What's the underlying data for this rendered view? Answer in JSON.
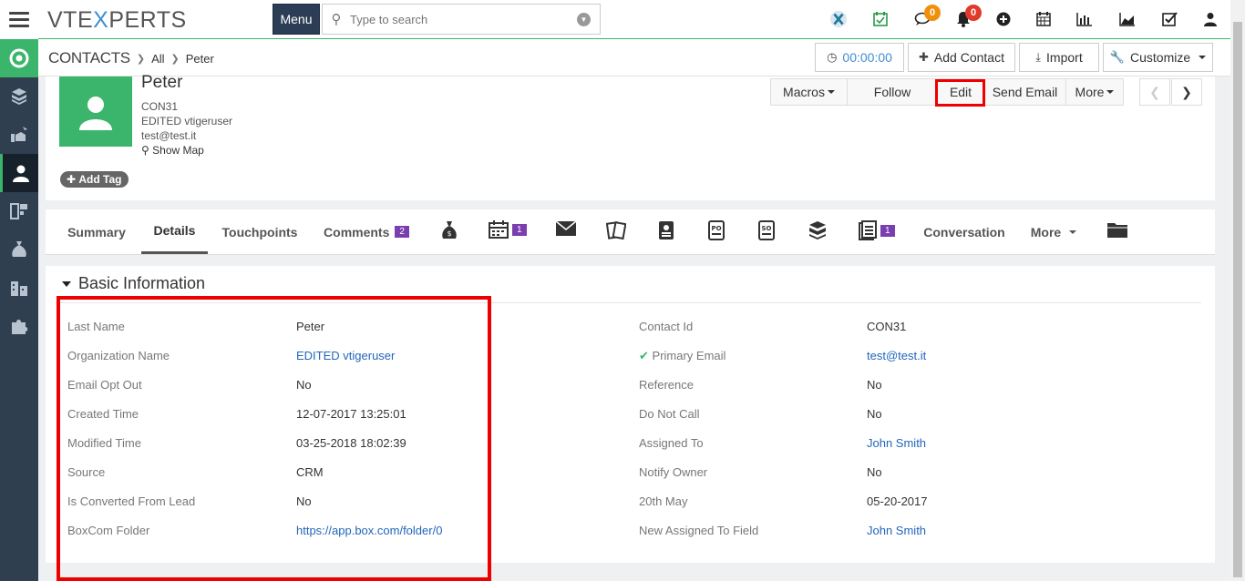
{
  "topbar": {
    "logo_left": "VTE",
    "logo_x": "X",
    "logo_right": "PERTS",
    "menu_label": "Menu",
    "search_placeholder": "Type to search",
    "chat_count": "0",
    "notif_count": "0",
    "chat_badge_color": "#f0900a",
    "notif_badge_color": "#e03a2a"
  },
  "breadcrumb": {
    "module": "CONTACTS",
    "filter": "All",
    "record": "Peter"
  },
  "header_buttons": {
    "timer": "00:00:00",
    "add_contact": "Add Contact",
    "import": "Import",
    "customize": "Customize"
  },
  "record": {
    "name": "Peter",
    "number": "CON31",
    "organization": "EDITED vtigeruser",
    "email": "test@test.it",
    "show_map": "Show Map",
    "add_tag": "Add Tag"
  },
  "actions": {
    "macros": "Macros",
    "follow": "Follow",
    "edit": "Edit",
    "send_email": "Send Email",
    "more": "More"
  },
  "tabs": {
    "summary": "Summary",
    "details": "Details",
    "touchpoints": "Touchpoints",
    "comments": "Comments",
    "comments_count": "2",
    "calendar_count": "1",
    "docs_count": "1",
    "conversation": "Conversation",
    "more": "More"
  },
  "section": {
    "title": "Basic Information",
    "left_fields": [
      {
        "label": "Last Name",
        "value": "Peter"
      },
      {
        "label": "Organization Name",
        "value": "EDITED vtigeruser"
      },
      {
        "label": "Email Opt Out",
        "value": "No"
      },
      {
        "label": "Created Time",
        "value": "12-07-2017 13:25:01"
      },
      {
        "label": "Modified Time",
        "value": "03-25-2018 18:02:39"
      },
      {
        "label": "Source",
        "value": "CRM"
      },
      {
        "label": "Is Converted From Lead",
        "value": "No"
      },
      {
        "label": "BoxCom Folder",
        "value": "https://app.box.com/folder/0"
      }
    ],
    "right_fields": [
      {
        "label": "Contact Id",
        "value": "CON31"
      },
      {
        "label": "Primary Email",
        "value": "test@test.it"
      },
      {
        "label": "Reference",
        "value": "No"
      },
      {
        "label": "Do Not Call",
        "value": "No"
      },
      {
        "label": "Assigned To",
        "value": "John Smith"
      },
      {
        "label": "Notify Owner",
        "value": "No"
      },
      {
        "label": "20th May",
        "value": "05-20-2017"
      },
      {
        "label": "New Assigned To Field",
        "value": "John Smith"
      }
    ]
  },
  "colors": {
    "accent_green": "#3ab56b",
    "sidebar_bg": "#2f3f50",
    "link_blue": "#2266bb",
    "highlight_red": "#e00000",
    "count_purple": "#7a3eaf"
  }
}
